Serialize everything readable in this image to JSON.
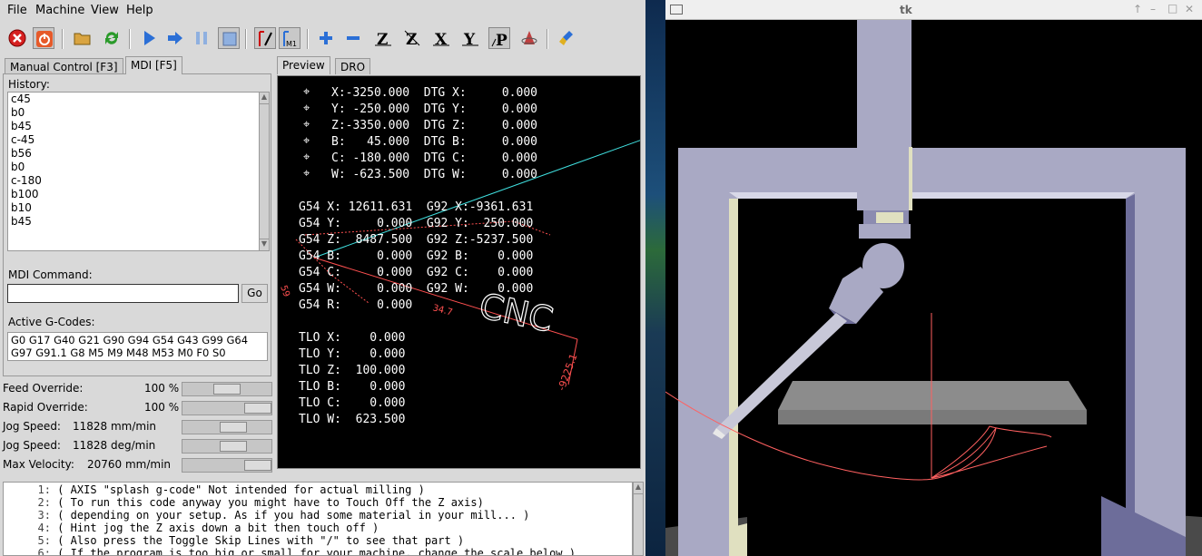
{
  "menubar": {
    "items": [
      "File",
      "Machine",
      "View",
      "Help"
    ]
  },
  "toolbar": {
    "icons": [
      "estop-icon",
      "power-icon",
      "open-file-icon",
      "reload-icon",
      "run-icon",
      "step-icon",
      "pause-icon",
      "stop-icon",
      "skip-lines-icon",
      "optional-stop-icon",
      "zoom-in-icon",
      "zoom-out-icon",
      "view-z-icon",
      "view-z2-icon",
      "view-x-icon",
      "view-y-icon",
      "view-p-icon",
      "rotate-icon",
      "clear-plot-icon"
    ],
    "view_labels": {
      "z": "Z",
      "z2": "Z",
      "x": "X",
      "y": "Y",
      "p": "P",
      "m1": "M1"
    }
  },
  "left_tabs": [
    {
      "label": "Manual Control [F3]"
    },
    {
      "label": "MDI [F5]"
    }
  ],
  "mdi": {
    "history_label": "History:",
    "history": [
      "c45",
      "b0",
      "b45",
      "c-45",
      "b56",
      "b0",
      "c-180",
      "b100",
      "b10",
      "b45"
    ],
    "command_label": "MDI Command:",
    "command_value": "",
    "go_label": "Go",
    "active_label": "Active G-Codes:",
    "active_line1": "G0 G17 G40 G21 G90 G94 G54 G43 G99 G64",
    "active_line2": "G97 G91.1 G8 M5 M9 M48 M53 M0 F0 S0"
  },
  "overrides": [
    {
      "name": "Feed Override:",
      "value": "100 %",
      "fraction": 0.5
    },
    {
      "name": "Rapid Override:",
      "value": "100 %",
      "fraction": 1.0
    },
    {
      "name": "Jog Speed:",
      "value": "11828 mm/min",
      "fraction": 0.6
    },
    {
      "name": "Jog Speed:",
      "value": "11828 deg/min",
      "fraction": 0.6
    },
    {
      "name": "Max Velocity:",
      "value": "20760 mm/min",
      "fraction": 1.0
    }
  ],
  "preview_tabs": [
    {
      "label": "Preview"
    },
    {
      "label": "DRO"
    }
  ],
  "dro": {
    "axis_lines": [
      "X:-3250.000  DTG X:     0.000",
      "Y: -250.000  DTG Y:     0.000",
      "Z:-3350.000  DTG Z:     0.000",
      "B:   45.000  DTG B:     0.000",
      "C: -180.000  DTG C:     0.000",
      "W: -623.500  DTG W:     0.000"
    ],
    "offset_lines": [
      "G54 X: 12611.631  G92 X:-9361.631",
      "G54 Y:     0.000  G92 Y:  250.000",
      "G54 Z:  8487.500  G92 Z:-5237.500",
      "G54 B:     0.000  G92 B:    0.000",
      "G54 C:     0.000  G92 C:    0.000",
      "G54 W:     0.000  G92 W:    0.000",
      "G54 R:     0.000"
    ],
    "tlo_lines": [
      "TLO X:    0.000",
      "TLO Y:    0.000",
      "TLO Z:  100.000",
      "TLO B:    0.000",
      "TLO C:    0.000",
      "TLO W:  623.500"
    ],
    "preview_texts": {
      "logo": "CNC",
      "dim1": "-9225.1",
      "dim2": "34.7",
      "dim3": "59"
    }
  },
  "gcode": [
    {
      "num": "1:",
      "text": "( AXIS \"splash g-code\" Not intended for actual milling )"
    },
    {
      "num": "2:",
      "text": "( To run this code anyway you might have to Touch Off the Z axis)"
    },
    {
      "num": "3:",
      "text": "( depending on your setup. As if you had some material in your mill... )"
    },
    {
      "num": "4:",
      "text": "( Hint jog the Z axis down a bit then touch off )"
    },
    {
      "num": "5:",
      "text": "( Also press the Toggle Skip Lines with \"/\" to see that part )"
    },
    {
      "num": "6:",
      "text": "( If the program is too big or small for your machine, change the scale below )"
    }
  ],
  "tk": {
    "title": "tk",
    "controls": [
      "↑",
      "–",
      "□",
      "✕"
    ]
  },
  "colors": {
    "panel": "#d9d9d9",
    "machine": "#a8a8c0",
    "machine_dark": "#6e6e96",
    "path": "#ff6060",
    "gantry_light": "#e0e0c0"
  }
}
